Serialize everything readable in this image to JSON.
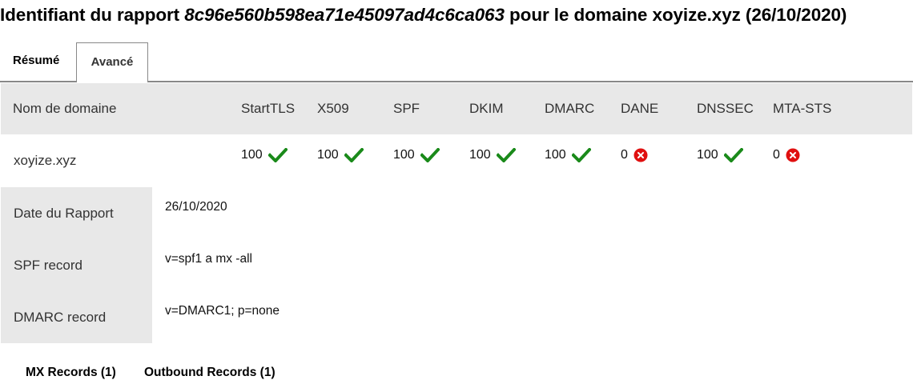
{
  "title": {
    "prefix": "Identifiant du rapport ",
    "report_id": "8c96e560b598ea71e45097ad4c6ca063",
    "suffix": " pour le domaine xoyize.xyz (26/10/2020)"
  },
  "tabs": [
    {
      "label": "Résumé",
      "active": false
    },
    {
      "label": "Avancé",
      "active": true
    }
  ],
  "table": {
    "headers": [
      "Nom de domaine",
      "StartTLS",
      "X509",
      "SPF",
      "DKIM",
      "DMARC",
      "DANE",
      "DNSSEC",
      "MTA-STS"
    ],
    "row": {
      "domain": "xoyize.xyz",
      "scores": [
        {
          "value": "100",
          "status": "ok"
        },
        {
          "value": "100",
          "status": "ok"
        },
        {
          "value": "100",
          "status": "ok"
        },
        {
          "value": "100",
          "status": "ok"
        },
        {
          "value": "100",
          "status": "ok"
        },
        {
          "value": "0",
          "status": "fail"
        },
        {
          "value": "100",
          "status": "ok"
        },
        {
          "value": "0",
          "status": "fail"
        }
      ]
    }
  },
  "details": [
    {
      "label": "Date du Rapport",
      "value": "26/10/2020"
    },
    {
      "label": "SPF record",
      "value": "v=spf1 a mx -all"
    },
    {
      "label": "DMARC record",
      "value": "v=DMARC1; p=none"
    }
  ],
  "subtabs": [
    "MX Records (1)",
    "Outbound Records (1)"
  ],
  "colors": {
    "ok": "#1a8a1a",
    "fail": "#e01010",
    "header_bg": "#e8e8e8"
  },
  "icons": {
    "ok": "checkmark-icon",
    "fail": "error-circle-icon"
  }
}
